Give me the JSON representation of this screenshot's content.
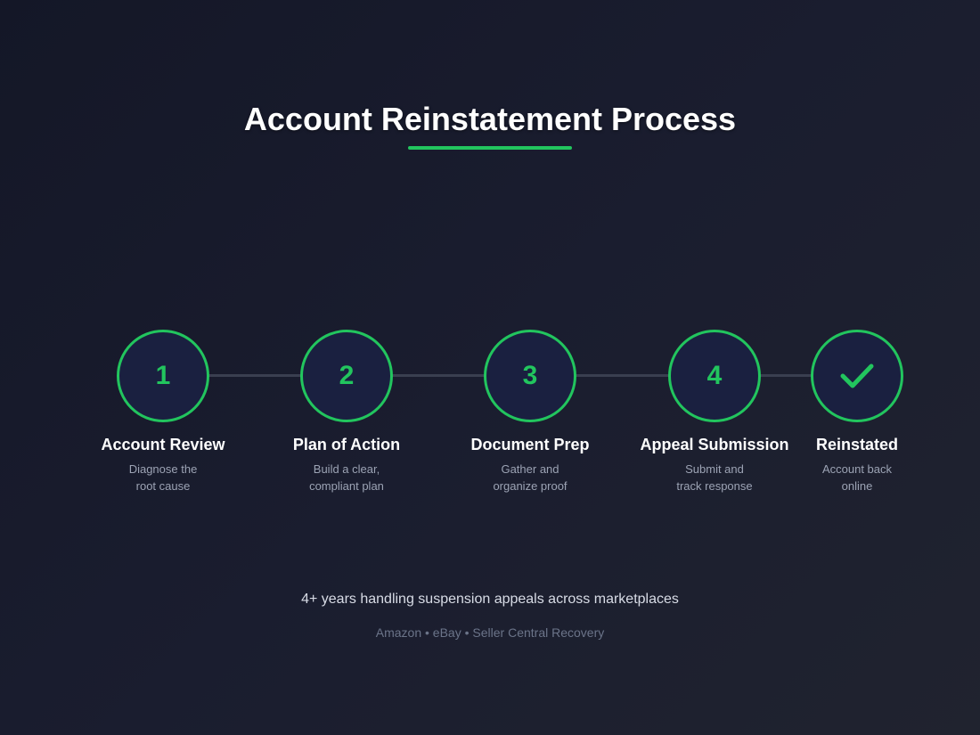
{
  "header": {
    "title": "Account Reinstatement Process"
  },
  "colors": {
    "accent": "#22c55e",
    "background": "#1a1d2f",
    "circle_fill": "#1a2040",
    "connector": "#3a3f50"
  },
  "steps": [
    {
      "marker": "1",
      "label": "Account Review",
      "desc_line1": "Diagnose the",
      "desc_line2": "root cause"
    },
    {
      "marker": "2",
      "label": "Plan of Action",
      "desc_line1": "Build a clear,",
      "desc_line2": "compliant plan"
    },
    {
      "marker": "3",
      "label": "Document Prep",
      "desc_line1": "Gather and",
      "desc_line2": "organize proof"
    },
    {
      "marker": "4",
      "label": "Appeal Submission",
      "desc_line1": "Submit and",
      "desc_line2": "track response"
    },
    {
      "marker_icon": "checkmark-icon",
      "label": "Reinstated",
      "desc_line1": "Account back",
      "desc_line2": "online"
    }
  ],
  "footer": {
    "tagline": "4+ years handling suspension appeals across marketplaces",
    "platforms": "Amazon • eBay • Seller Central Recovery"
  }
}
